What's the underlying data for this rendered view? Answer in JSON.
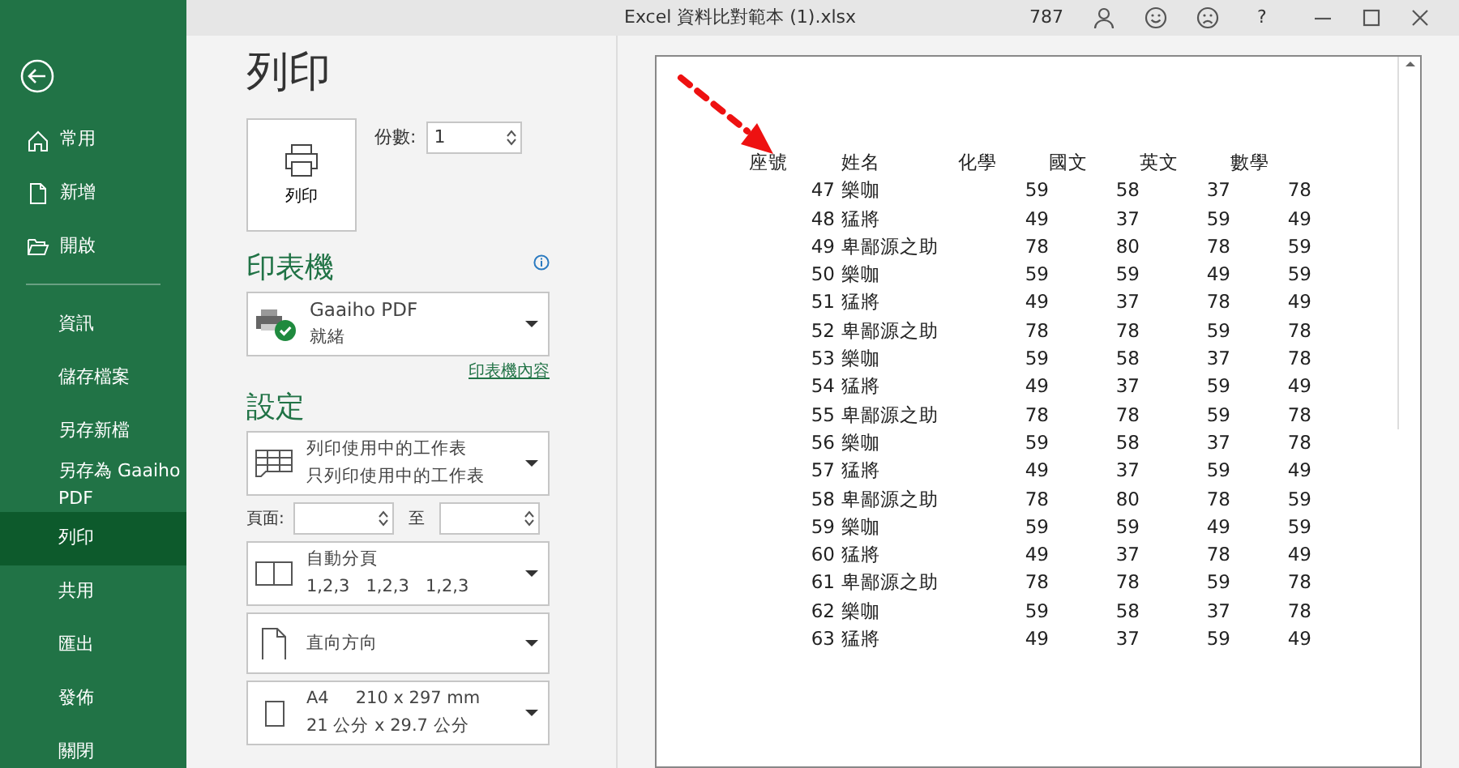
{
  "window": {
    "title": "Excel 資料比對範本 (1).xlsx",
    "counter": "787",
    "help": "?"
  },
  "sidebar": {
    "items": [
      {
        "label": "常用",
        "kind": "home",
        "selected": false
      },
      {
        "label": "新增",
        "kind": "new",
        "selected": false
      },
      {
        "label": "開啟",
        "kind": "open",
        "selected": false
      },
      {
        "label": "資訊",
        "kind": "plain",
        "selected": false
      },
      {
        "label": "儲存檔案",
        "kind": "plain",
        "selected": false
      },
      {
        "label": "另存新檔",
        "kind": "plain",
        "selected": false
      },
      {
        "label": "另存為 Gaaiho PDF",
        "kind": "plain",
        "selected": false
      },
      {
        "label": "列印",
        "kind": "plain",
        "selected": true
      },
      {
        "label": "共用",
        "kind": "plain",
        "selected": false
      },
      {
        "label": "匯出",
        "kind": "plain",
        "selected": false
      },
      {
        "label": "發佈",
        "kind": "plain",
        "selected": false
      },
      {
        "label": "關閉",
        "kind": "plain",
        "selected": false
      }
    ]
  },
  "page_title": "列印",
  "print_button": {
    "label": "列印"
  },
  "copies": {
    "label": "份數:",
    "value": "1"
  },
  "printer": {
    "heading": "印表機",
    "name": "Gaaiho PDF",
    "status": "就緒",
    "properties_link": "印表機內容"
  },
  "settings": {
    "heading": "設定",
    "items": [
      {
        "kind": "sheets",
        "line1": "列印使用中的工作表",
        "line2": "只列印使用中的工作表"
      },
      {
        "kind": "page-range",
        "label": "頁面:",
        "to_label": "至"
      },
      {
        "kind": "collate",
        "line1": "自動分頁",
        "line2": "1,2,3   1,2,3   1,2,3"
      },
      {
        "kind": "orientation",
        "line1": "直向方向"
      },
      {
        "kind": "paper",
        "line1": "A4",
        "detail": "210 x 297 mm",
        "line2": "21 公分 x 29.7 公分"
      }
    ]
  },
  "preview": {
    "columns": [
      "座號",
      "姓名",
      "化學",
      "國文",
      "英文",
      "數學"
    ],
    "rows": [
      [
        "47",
        "樂咖",
        "59",
        "58",
        "37",
        "78"
      ],
      [
        "48",
        "猛將",
        "49",
        "37",
        "59",
        "49"
      ],
      [
        "49",
        "卑鄙源之助",
        "78",
        "80",
        "78",
        "59"
      ],
      [
        "50",
        "樂咖",
        "59",
        "59",
        "49",
        "59"
      ],
      [
        "51",
        "猛將",
        "49",
        "37",
        "78",
        "49"
      ],
      [
        "52",
        "卑鄙源之助",
        "78",
        "78",
        "59",
        "78"
      ],
      [
        "53",
        "樂咖",
        "59",
        "58",
        "37",
        "78"
      ],
      [
        "54",
        "猛將",
        "49",
        "37",
        "59",
        "49"
      ],
      [
        "55",
        "卑鄙源之助",
        "78",
        "78",
        "59",
        "78"
      ],
      [
        "56",
        "樂咖",
        "59",
        "58",
        "37",
        "78"
      ],
      [
        "57",
        "猛將",
        "49",
        "37",
        "59",
        "49"
      ],
      [
        "58",
        "卑鄙源之助",
        "78",
        "80",
        "78",
        "59"
      ],
      [
        "59",
        "樂咖",
        "59",
        "59",
        "49",
        "59"
      ],
      [
        "60",
        "猛將",
        "49",
        "37",
        "78",
        "49"
      ],
      [
        "61",
        "卑鄙源之助",
        "78",
        "78",
        "59",
        "78"
      ],
      [
        "62",
        "樂咖",
        "59",
        "58",
        "37",
        "78"
      ],
      [
        "63",
        "猛將",
        "49",
        "37",
        "59",
        "49"
      ]
    ]
  }
}
